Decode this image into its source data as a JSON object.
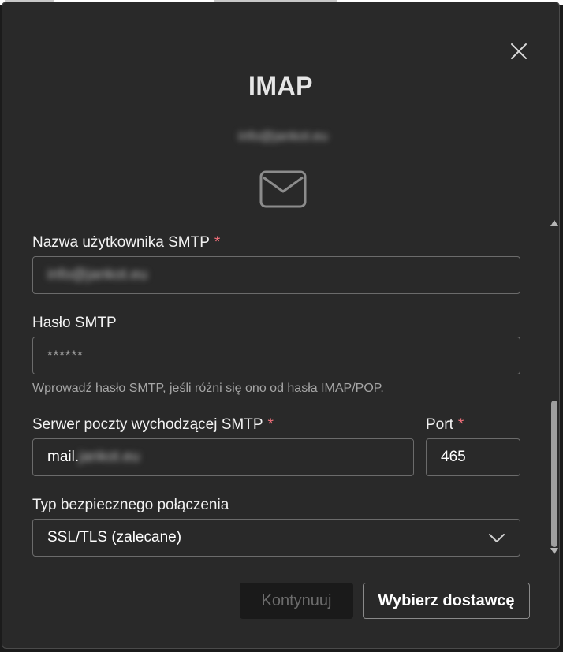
{
  "dialog": {
    "title": "IMAP",
    "account_email": "info@jankot.eu",
    "close_label": "Zamknij"
  },
  "form": {
    "smtp_username": {
      "label": "Nazwa użytkownika SMTP",
      "required_mark": "*",
      "value": "info@jankot.eu"
    },
    "smtp_password": {
      "label": "Hasło SMTP",
      "placeholder": "******",
      "hint": "Wprowadź hasło SMTP, jeśli różni się ono od hasła IMAP/POP."
    },
    "smtp_server": {
      "label": "Serwer poczty wychodzącej SMTP",
      "required_mark": "*",
      "value_prefix": "mail.",
      "value_masked": "jankot.eu"
    },
    "port": {
      "label": "Port",
      "required_mark": "*",
      "value": "465"
    },
    "security": {
      "label": "Typ bezpiecznego połączenia",
      "selected": "SSL/TLS (zalecane)"
    }
  },
  "buttons": {
    "continue_label": "Kontynuuj",
    "choose_provider_label": "Wybierz dostawcę"
  },
  "colors": {
    "dialog_bg": "#292929",
    "required": "#f1707b",
    "input_border": "#6b6b6b",
    "disabled_text": "#6c6c6c"
  }
}
